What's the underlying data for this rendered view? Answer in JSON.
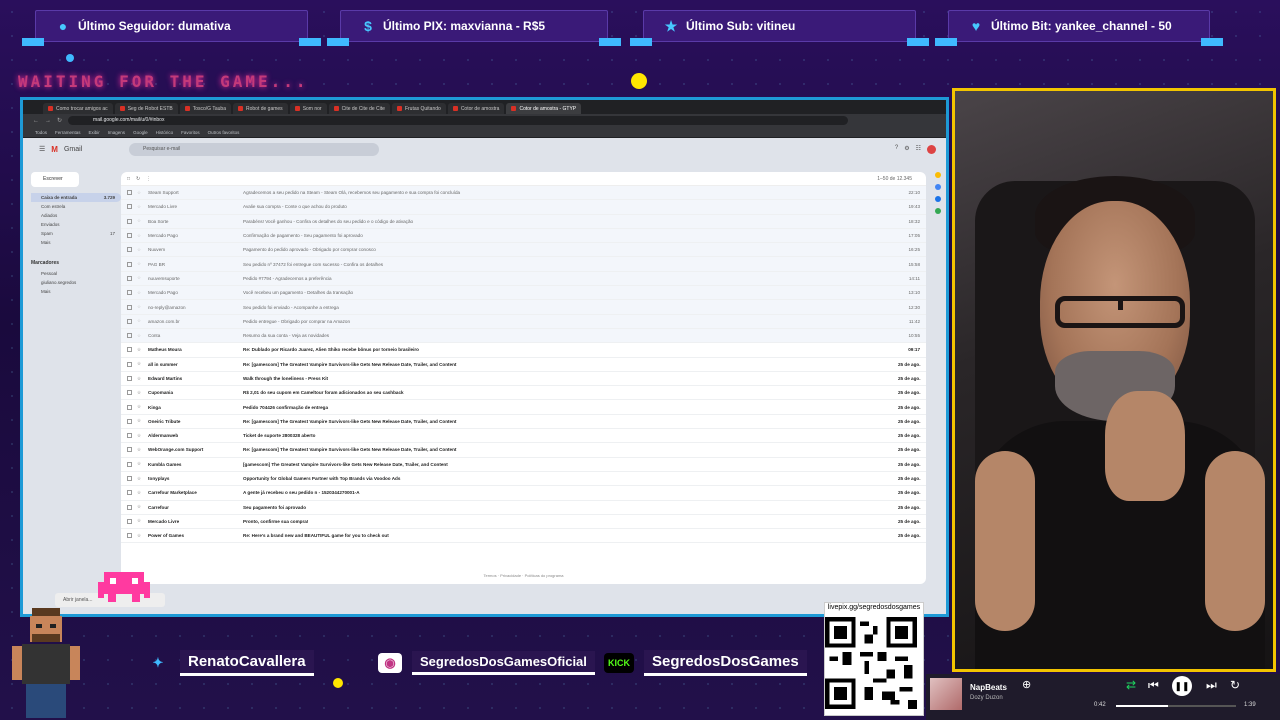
{
  "alerts": {
    "seguidor": "Último Seguidor: dumativa",
    "pix": "Último PIX: maxvianna - R$5",
    "sub": "Último Sub: vitineu",
    "bit": "Último Bit: yankee_channel - 50"
  },
  "waiting_text": "WAITING FOR THE GAME...",
  "browser": {
    "tabs": [
      "Como trocar amigos ac",
      "Seg de Robot ESTB",
      "Tosco/G Tauba",
      "Robot de games",
      "Som nor",
      "Cite de Cite de Cite",
      "Frutas Quitando",
      "Cotor de amostra",
      "Cotor de amostra - GTYP"
    ],
    "url": "mail.google.com/mail/u/0/#inbox",
    "bookmarks": [
      "Todos",
      "Ferramentas",
      "Exibir",
      "Imagens",
      "Google",
      "Histórico",
      "Favoritos",
      "Outros favoritos"
    ]
  },
  "gmail": {
    "brand": "Gmail",
    "search_placeholder": "Pesquisar e-mail",
    "compose": "Escrever",
    "sidebar": [
      {
        "label": "Caixa de entrada",
        "count": "3.729"
      },
      {
        "label": "Com estrela",
        "count": ""
      },
      {
        "label": "Adiados",
        "count": ""
      },
      {
        "label": "Enviados",
        "count": ""
      },
      {
        "label": "Spam",
        "count": "17"
      },
      {
        "label": "Mais",
        "count": ""
      }
    ],
    "labels_title": "Marcadores",
    "labels": [
      "Pessoal",
      "giuliano.segredos",
      "Mais"
    ],
    "pagination": "1–50 de 12.345",
    "rows": [
      {
        "from": "Steam Support",
        "subject": "Agradecemos a seu pedido na Steam - Steam Olá, recebemos seu pagamento e sua compra foi concluída",
        "date": "22:10",
        "unread": false
      },
      {
        "from": "Mercado Livre",
        "subject": "Avalie sua compra - Conte o que achou do produto",
        "date": "19:43",
        "unread": false
      },
      {
        "from": "Boa Sorte",
        "subject": "Parabéns! Você ganhou - Confira os detalhes do seu pedido e o código de ativação",
        "date": "18:32",
        "unread": false
      },
      {
        "from": "Mercado Pago",
        "subject": "Confirmação de pagamento - Seu pagamento foi aprovado",
        "date": "17:05",
        "unread": false
      },
      {
        "from": "Nuuvem",
        "subject": "Pagamento do pedido aprovado - Obrigado por comprar conosco",
        "date": "16:25",
        "unread": false
      },
      {
        "from": "PAG BR",
        "subject": "Seu pedido nº 37472 foi entregue com sucesso - Confira os detalhes",
        "date": "15:58",
        "unread": false
      },
      {
        "from": "nuuvemsuporte",
        "subject": "Pedido #7794 - Agradecemos a preferência",
        "date": "14:11",
        "unread": false
      },
      {
        "from": "Mercado Pago",
        "subject": "Você recebeu um pagamento - Detalhes da transação",
        "date": "13:10",
        "unread": false
      },
      {
        "from": "no-reply@amazon",
        "subject": "Seu pedido foi enviado - Acompanhe a entrega",
        "date": "12:30",
        "unread": false
      },
      {
        "from": "amazon.com.br",
        "subject": "Pedido entregue - Obrigado por comprar na Amazon",
        "date": "11:42",
        "unread": false
      },
      {
        "from": "Conta",
        "subject": "Resumo da sua conta - Veja as novidades",
        "date": "10:55",
        "unread": false
      },
      {
        "from": "Matheus Moura",
        "subject": "Re: Dublado por Ricardo Juarez, Alien Shiko recebe bônus por torneio brasileiro",
        "date": "09:17",
        "unread": true
      },
      {
        "from": "all in summer",
        "subject": "Re: [gamescom] The Greatest Vampire Survivors-like Gets New Release Date, Trailer, and Content",
        "date": "25 de ago.",
        "unread": true
      },
      {
        "from": "Edward Martins",
        "subject": "Walk through the loneliness - Press Kit",
        "date": "25 de ago.",
        "unread": true
      },
      {
        "from": "Cupomania",
        "subject": "R$ 2,01 do seu cupom em Cameltour foram adicionados ao seu cashback",
        "date": "25 de ago.",
        "unread": true
      },
      {
        "from": "Kinga",
        "subject": "Pedido 704426 confirmação de entrega",
        "date": "25 de ago.",
        "unread": true
      },
      {
        "from": "Oneiric Tribute",
        "subject": "Re: [gamescom] The Greatest Vampire Survivors-like Gets New Release Date, Trailer, and Content",
        "date": "25 de ago.",
        "unread": true
      },
      {
        "from": "Aldermanweb",
        "subject": "Ticket de suporte 2800328 aberto",
        "date": "25 de ago.",
        "unread": true
      },
      {
        "from": "WebOrange.com Support",
        "subject": "Re: [gamescom] The Greatest Vampire Survivors-like Gets New Release Date, Trailer, and Content",
        "date": "25 de ago.",
        "unread": true
      },
      {
        "from": "Kumbla Games",
        "subject": "[gamescom] The Greatest Vampire Survivors-like Gets New Release Date, Trailer, and Content",
        "date": "25 de ago.",
        "unread": true
      },
      {
        "from": "tonyplays",
        "subject": "Opportunity for Global Gamers Partner with Top Brands via Voodoo Ads",
        "date": "25 de ago.",
        "unread": true
      },
      {
        "from": "Carrefour Marketplace",
        "subject": "A gente já recebeu o seu pedido n - 1520344270001-A",
        "date": "25 de ago.",
        "unread": true
      },
      {
        "from": "Carrefour",
        "subject": "Seu pagamento foi aprovado",
        "date": "25 de ago.",
        "unread": true
      },
      {
        "from": "Mercado Livre",
        "subject": "Pronto, confirme sua compra!",
        "date": "25 de ago.",
        "unread": true
      },
      {
        "from": "Power of Games",
        "subject": "Re: Here's a brand new and BEAUTIFUL game for you to check out",
        "date": "25 de ago.",
        "unread": true
      }
    ],
    "footer": "Termos · Privacidade · Políticas do programa"
  },
  "taskbar_chip": "Abrir janela...",
  "social": {
    "twitter": "RenatoCavallera",
    "instagram": "SegredosDosGamesOficial",
    "kick": "SegredosDosGames"
  },
  "qr_label": "livepix.gg/segredosdosgames",
  "music": {
    "track": "NapBeats",
    "artist": "Dozy Duzon",
    "elapsed": "0:42",
    "duration": "1:39",
    "progress": 0.43
  },
  "colors": {
    "accent": "#3fb9ff",
    "alert_bg": "#3a1a78",
    "cam_border": "#f2c400",
    "waiting": "#c43a7a"
  }
}
